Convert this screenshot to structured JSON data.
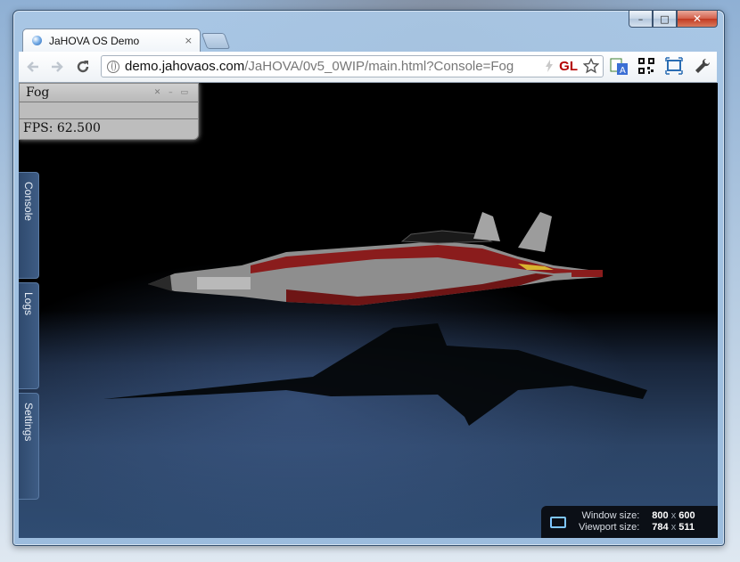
{
  "browser": {
    "tab_title": "JaHOVA OS Demo",
    "tab_close": "×",
    "url_host": "demo.jahovaos.com",
    "url_path": "/JaHOVA/0v5_0WIP/main.html?Console=Fog",
    "gl_badge": "GL"
  },
  "window_controls": {
    "minimize": "–",
    "maximize": "□",
    "close": "✕"
  },
  "fog_panel": {
    "title": "Fog",
    "controls": "✕ – ▭",
    "fps": "FPS: 62.500"
  },
  "side_tabs": [
    "Console",
    "Logs",
    "Settings"
  ],
  "info": {
    "window_label": "Window size:",
    "viewport_label": "Viewport size:",
    "window_w": "800",
    "window_h": "600",
    "viewport_w": "784",
    "viewport_h": "511",
    "times": "x"
  },
  "colors": {
    "accent_gl": "#b40000",
    "ship_red": "#8a1c1c",
    "ship_grey": "#9a9a9a"
  }
}
